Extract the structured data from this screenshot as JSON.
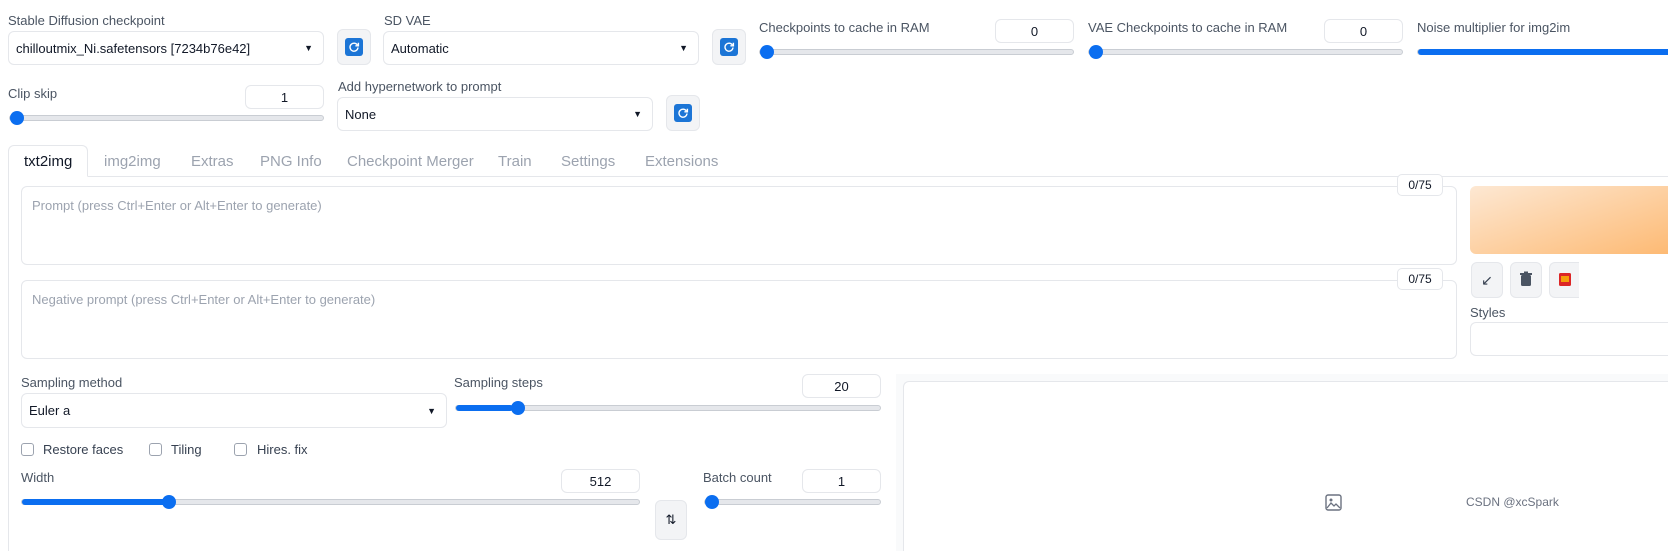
{
  "top_settings": {
    "checkpoint": {
      "label": "Stable Diffusion checkpoint",
      "value": "chilloutmix_Ni.safetensors [7234b76e42]"
    },
    "vae": {
      "label": "SD VAE",
      "value": "Automatic"
    },
    "ckpt_cache": {
      "label": "Checkpoints to cache in RAM",
      "value": "0",
      "fraction": 0.0
    },
    "vae_cache": {
      "label": "VAE Checkpoints to cache in RAM",
      "value": "0",
      "fraction": 0.0
    },
    "noise_multiplier": {
      "label": "Noise multiplier for img2im",
      "fraction": 1.0
    },
    "clip_skip": {
      "label": "Clip skip",
      "value": "1",
      "fraction": 0.0
    },
    "hypernetwork": {
      "label": "Add hypernetwork to prompt",
      "value": "None"
    }
  },
  "tabs": [
    {
      "label": "txt2img",
      "active": true
    },
    {
      "label": "img2img"
    },
    {
      "label": "Extras"
    },
    {
      "label": "PNG Info"
    },
    {
      "label": "Checkpoint Merger"
    },
    {
      "label": "Train"
    },
    {
      "label": "Settings"
    },
    {
      "label": "Extensions"
    }
  ],
  "prompt": {
    "placeholder": "Prompt (press Ctrl+Enter or Alt+Enter to generate)",
    "counter": "0/75"
  },
  "negative_prompt": {
    "placeholder": "Negative prompt (press Ctrl+Enter or Alt+Enter to generate)",
    "counter": "0/75"
  },
  "styles_label": "Styles",
  "sampling": {
    "method_label": "Sampling method",
    "method_value": "Euler a",
    "steps_label": "Sampling steps",
    "steps_value": "20",
    "steps_fraction": 0.135
  },
  "checkboxes": {
    "restore_faces": "Restore faces",
    "tiling": "Tiling",
    "hires_fix": "Hires. fix"
  },
  "width": {
    "label": "Width",
    "value": "512",
    "fraction": 0.233
  },
  "batch_count": {
    "label": "Batch count",
    "value": "1",
    "fraction": 0.0
  },
  "watermark": "CSDN @xcSpark",
  "colors": {
    "accent": "#0b6ef0",
    "refresh_icon": "#1c75d6",
    "generate_start": "#fde8d3",
    "generate_end": "#fdba74"
  },
  "icons": [
    "refresh-icon",
    "arrow-icon",
    "trash-icon",
    "clipboard-icon",
    "image-icon",
    "swap-icon"
  ]
}
